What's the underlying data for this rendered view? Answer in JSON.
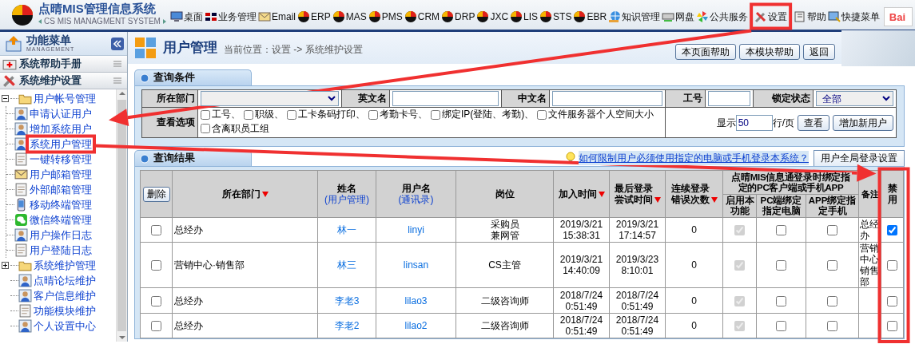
{
  "header": {
    "title": "点晴MIS管理信息系统",
    "subtitle": "CS MIS MANAGMENT SYSTEM",
    "search_logo": "Bai",
    "nav": [
      {
        "label": "桌面",
        "kind": "monitor",
        "highlighted": false
      },
      {
        "label": "业务管理",
        "kind": "flag",
        "highlighted": false
      },
      {
        "label": "Email",
        "kind": "mail",
        "highlighted": false
      },
      {
        "label": "ERP",
        "kind": "ball",
        "highlighted": false
      },
      {
        "label": "MAS",
        "kind": "ball",
        "highlighted": false
      },
      {
        "label": "PMS",
        "kind": "ball",
        "highlighted": false
      },
      {
        "label": "CRM",
        "kind": "ball",
        "highlighted": false
      },
      {
        "label": "DRP",
        "kind": "ball",
        "highlighted": false
      },
      {
        "label": "JXC",
        "kind": "ball",
        "highlighted": false
      },
      {
        "label": "LIS",
        "kind": "ball",
        "highlighted": false
      },
      {
        "label": "STS",
        "kind": "ball",
        "highlighted": false
      },
      {
        "label": "EBR",
        "kind": "ball",
        "highlighted": false
      },
      {
        "label": "知识管理",
        "kind": "globe",
        "highlighted": false
      },
      {
        "label": "网盘",
        "kind": "disk",
        "highlighted": false
      },
      {
        "label": "公共服务",
        "kind": "pinwheel",
        "highlighted": false
      },
      {
        "label": "设置",
        "kind": "tools",
        "highlighted": true
      },
      {
        "label": "帮助",
        "kind": "book",
        "highlighted": false
      },
      {
        "label": "快捷菜单",
        "kind": "shortcut",
        "highlighted": false
      }
    ]
  },
  "sidebar": {
    "title": "功能菜单",
    "subtitle": "MANAGEMENT",
    "sections": [
      {
        "label": "系统帮助手册",
        "kind": "medkit"
      },
      {
        "label": "系统维护设置",
        "kind": "tools"
      }
    ],
    "tree": [
      {
        "label": "用户帐号管理",
        "kind": "folder",
        "expanded": true,
        "highlighted": false,
        "children": [
          {
            "label": "申请认证用户",
            "kind": "user",
            "highlighted": false
          },
          {
            "label": "增加系统用户",
            "kind": "user",
            "highlighted": false
          },
          {
            "label": "系统用户管理",
            "kind": "user",
            "highlighted": true
          },
          {
            "label": "一键转移管理",
            "kind": "page",
            "highlighted": false
          },
          {
            "label": "用户邮箱管理",
            "kind": "mail",
            "highlighted": false
          },
          {
            "label": "外部邮箱管理",
            "kind": "page",
            "highlighted": false
          },
          {
            "label": "移动终端管理",
            "kind": "phone",
            "highlighted": false
          },
          {
            "label": "微信终端管理",
            "kind": "chat",
            "highlighted": false
          },
          {
            "label": "用户操作日志",
            "kind": "user",
            "highlighted": false
          },
          {
            "label": "用户登陆日志",
            "kind": "page",
            "highlighted": false
          }
        ]
      },
      {
        "label": "系统维护管理",
        "kind": "folder",
        "expanded": false,
        "highlighted": false
      },
      {
        "label": "点晴论坛维护",
        "kind": "user",
        "highlighted": false
      },
      {
        "label": "客户信息维护",
        "kind": "user",
        "highlighted": false
      },
      {
        "label": "功能模块维护",
        "kind": "page",
        "highlighted": false
      },
      {
        "label": "个人设置中心",
        "kind": "user",
        "highlighted": false
      }
    ]
  },
  "page": {
    "title": "用户管理",
    "breadcrumb": "当前位置：设置 -> 系统维护设置",
    "buttons": [
      "本页面帮助",
      "本模块帮助",
      "返回"
    ]
  },
  "query": {
    "tab": "查询条件",
    "fields": [
      {
        "label": "所在部门",
        "kind": "select"
      },
      {
        "label": "英文名",
        "kind": "input"
      },
      {
        "label": "中文名",
        "kind": "input"
      },
      {
        "label": "工号",
        "kind": "input"
      },
      {
        "label": "锁定状态",
        "kind": "select",
        "value": "全部"
      }
    ],
    "options_label": "查看选项",
    "options": [
      {
        "label": "工号、",
        "checked": false
      },
      {
        "label": "职级、",
        "checked": false
      },
      {
        "label": "工卡条码打印、",
        "checked": false
      },
      {
        "label": "考勤卡号、",
        "checked": false
      },
      {
        "label": "绑定IP(登陆、考勤)、",
        "checked": false
      },
      {
        "label": "文件服务器个人空间大小",
        "checked": false
      },
      {
        "label": "含离职员工组",
        "checked": false
      }
    ],
    "page_size": {
      "before": "显示",
      "value": "50",
      "after": "行/页"
    },
    "buttons": [
      "查看",
      "增加新用户"
    ]
  },
  "results": {
    "tab": "查询结果",
    "tip": "如何限制用户必须使用指定的电脑或手机登录本系统？",
    "settings_button": "用户全局登录设置",
    "delete_button": "删除",
    "columns": [
      {
        "label": "所在部门",
        "sorted": true,
        "highlighted": false
      },
      {
        "label": "姓名",
        "note": "(用户管理)",
        "sorted": false,
        "highlighted": false
      },
      {
        "label": "用户名",
        "note": "(通讯录)",
        "sorted": false,
        "highlighted": false
      },
      {
        "label": "岗位",
        "sorted": false,
        "highlighted": false
      },
      {
        "label": "加入时间",
        "sorted": true,
        "highlighted": false
      },
      {
        "label": "最后登录尝试时间",
        "sorted": true,
        "highlighted": false
      },
      {
        "label": "连续登录错误次数",
        "sorted": true,
        "highlighted": false
      },
      {
        "label": "点晴MIS信息通登录时绑定指定的PC客户端或手机APP",
        "sorted": false,
        "highlighted": false,
        "children": [
          {
            "label": "启用本功能"
          },
          {
            "label": "PC端绑定指定电脑"
          },
          {
            "label": "APP绑定指定手机"
          }
        ]
      },
      {
        "label": "备注",
        "sorted": false,
        "highlighted": false
      },
      {
        "label": "禁用",
        "sorted": false,
        "highlighted": true
      }
    ],
    "rows": [
      {
        "checked": false,
        "department": "总经办",
        "name": "林一",
        "username": "linyi",
        "positions": [
          "采购员",
          "兼网管"
        ],
        "joined": "2019/3/21\n15:38:31",
        "last_login": "2019/3/21\n17:14:57",
        "failures": "0",
        "bind_enabled": true,
        "bind_pc": false,
        "bind_app": false,
        "remark": "总经办",
        "disabled": true
      },
      {
        "checked": false,
        "department": "营销中心·销售部",
        "name": "林三",
        "username": "linsan",
        "positions": [
          "CS主管"
        ],
        "joined": "2019/3/21\n14:40:09",
        "last_login": "2019/3/23\n8:10:01",
        "failures": "0",
        "bind_enabled": true,
        "bind_pc": false,
        "bind_app": false,
        "remark": "营销中心销售部",
        "disabled": false
      },
      {
        "checked": false,
        "department": "总经办",
        "name": "李老3",
        "username": "lilao3",
        "positions": [
          "二级咨询师"
        ],
        "joined": "2018/7/24\n0:51:49",
        "last_login": "2018/7/24\n0:51:49",
        "failures": "0",
        "bind_enabled": true,
        "bind_pc": false,
        "bind_app": false,
        "disabled": false
      },
      {
        "checked": false,
        "department": "总经办",
        "name": "李老2",
        "username": "lilao2",
        "positions": [
          "二级咨询师"
        ],
        "joined": "2018/7/24\n0:51:49",
        "last_login": "2018/7/24\n0:51:49",
        "failures": "0",
        "bind_enabled": true,
        "bind_pc": false,
        "bind_app": false,
        "disabled": false
      }
    ]
  }
}
